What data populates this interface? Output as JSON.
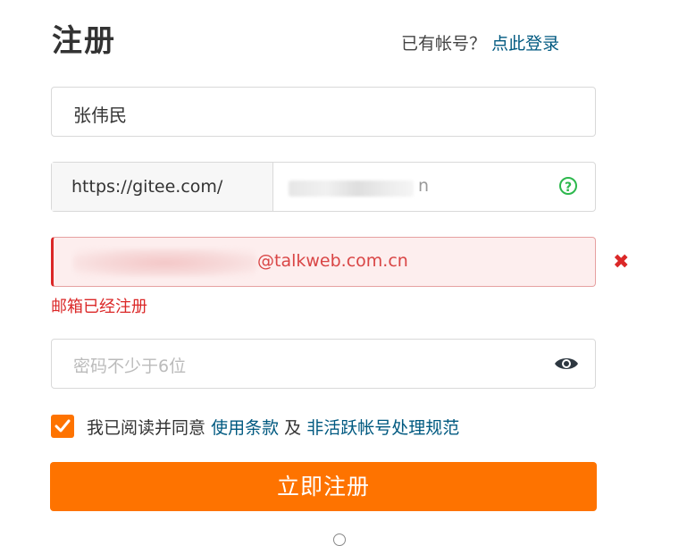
{
  "header": {
    "title": "注册",
    "login_prompt": "已有帐号？",
    "login_link": "点此登录"
  },
  "form": {
    "name": {
      "value": "张伟民"
    },
    "path": {
      "prefix": "https://gitee.com/",
      "value_tail": "n"
    },
    "email": {
      "value_suffix": "@talkweb.com.cn",
      "error_message": "邮箱已经注册",
      "state_color": "#db2828"
    },
    "password": {
      "placeholder": "密码不少于6位"
    },
    "agreement": {
      "checked": true,
      "prefix": "我已阅读并同意",
      "terms_link": "使用条款",
      "connector": "及",
      "policy_link": "非活跃帐号处理规范"
    },
    "submit_label": "立即注册"
  },
  "colors": {
    "accent": "#fe7300",
    "link": "#005980",
    "error": "#db2828",
    "help": "#2db84d"
  },
  "icons": {
    "path_help": "question-circle-icon",
    "email_error": "close-icon",
    "password_toggle": "eye-icon",
    "agreement_check": "checkmark-icon"
  }
}
